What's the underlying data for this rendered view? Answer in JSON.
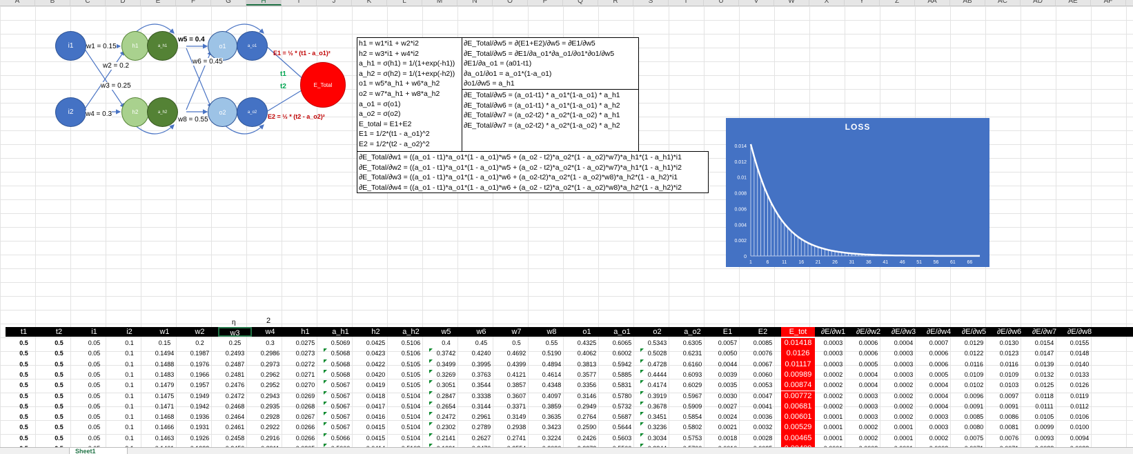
{
  "columns": [
    "A",
    "B",
    "C",
    "D",
    "E",
    "F",
    "G",
    "H",
    "I",
    "J",
    "K",
    "L",
    "M",
    "N",
    "O",
    "P",
    "Q",
    "R",
    "S",
    "T",
    "U",
    "V",
    "W",
    "X",
    "Y",
    "Z",
    "AA",
    "AB",
    "AC",
    "AD",
    "AE",
    "AF"
  ],
  "selected_column": "H",
  "diagram": {
    "nodes": {
      "i1": "i1",
      "i2": "i2",
      "h1": "h1",
      "h2": "h2",
      "a_h1": "a_h1",
      "a_h2": "a_h2",
      "o1": "o1",
      "o2": "o2",
      "a_o1": "a_o1",
      "a_o2": "a_o2",
      "E_total": "E_Total"
    },
    "weights": {
      "w1": "w1 = 0.15",
      "w2": "w2 = 0.2",
      "w3": "w3 = 0.25",
      "w4": "w4 = 0.3",
      "w5": "w5 = 0.4",
      "w6": "w6 = 0.45",
      "w8": "w8 = 0.55"
    },
    "targets": {
      "t1": "t1",
      "t2": "t2"
    },
    "errors": {
      "e1": "E1 = ½ * (t1 - a_o1)²",
      "e2": "E2 = ½ * (t2 - a_o2)²"
    }
  },
  "formulas_left": [
    "h1 = w1*i1 + w2*i2",
    "h2 = w3*i1 + w4*i2",
    "a_h1 = σ(h1) = 1/(1+exp(-h1))",
    "a_h2 = σ(h2) = 1/(1+exp(-h2))",
    "o1 = w5*a_h1 + w6*a_h2",
    "o2 = w7*a_h1 + w8*a_h2",
    "a_o1 = σ(o1)",
    "a_o2 = σ(o2)",
    "E_total = E1+E2",
    "E1 = 1/2*(t1 - a_o1)^2",
    "E2 = 1/2*(t2 - a_o2)^2"
  ],
  "formulas_right_top": [
    "∂E_Total/∂w5 = ∂(E1+E2)/∂w5 = ∂E1/∂w5",
    "∂E_Total/∂w5 = ∂E1/∂a_o1*∂a_o1/∂o1*∂o1/∂w5",
    "∂E1/∂a_o1 = (a01-t1)",
    "∂a_o1/∂o1 = a_o1*(1-a_o1)",
    "∂o1/∂w5 = a_h1"
  ],
  "formulas_right_bottom": [
    "∂E_Total/∂w5 = (a_o1-t1) * a_o1*(1-a_o1) * a_h1",
    "∂E_Total/∂w6 = (a_o1-t1) * a_o1*(1-a_o1) * a_h2",
    "∂E_Total/∂w7 = (a_o2-t2) * a_o2*(1-a_o2) * a_h1",
    "∂E_Total/∂w7 = (a_o2-t2) * a_o2*(1-a_o2) * a_h2"
  ],
  "formulas_wide": [
    "∂E_Total/∂w1 = ((a_o1 - t1)*a_o1*(1 - a_o1)*w5 + (a_o2 - t2)*a_o2*(1 - a_o2)*w7)*a_h1*(1 - a_h1)*i1",
    "∂E_Total/∂w2 = ((a_o1 - t1)*a_o1*(1 - a_o1)*w5 + (a_o2 - t2)*a_o2*(1 - a_o2)*w7)*a_h1*(1 - a_h1)*i2",
    "∂E_Total/∂w3 = ((a_o1 - t1)*a_o1*(1 - a_o1)*w6 + (a_o2-t2)*a_o2*(1 - a_o2)*w8)*a_h2*(1 - a_h2)*i1",
    "∂E_Total/∂w4 = ((a_o1 - t1)*a_o1*(1 - a_o1)*w6 + (a_o2 - t2)*a_o2*(1 - a_o2)*w8)*a_h2*(1 - a_h2)*i2"
  ],
  "eta": {
    "label": "η",
    "value": "2"
  },
  "chart_data": {
    "type": "area",
    "title": "LOSS",
    "xlabel": "",
    "ylabel": "",
    "ylim": [
      0,
      0.014
    ],
    "yticks": [
      "0",
      "0.002",
      "0.004",
      "0.006",
      "0.008",
      "0.01",
      "0.012",
      "0.014"
    ],
    "xticks": [
      "1",
      "6",
      "11",
      "16",
      "21",
      "26",
      "31",
      "36",
      "41",
      "46",
      "51",
      "56",
      "61",
      "66"
    ],
    "series": [
      {
        "values": [
          0.01418,
          0.0126,
          0.01117,
          0.00989,
          0.00874,
          0.00772,
          0.00681,
          0.00601,
          0.00529,
          0.00465,
          0.00409,
          0.0036,
          0.00316,
          0.00278,
          0.00244,
          0.00215,
          0.00189,
          0.00166,
          0.00146,
          0.00129,
          0.00113,
          0.001,
          0.00088,
          0.00077,
          0.00068,
          0.0006,
          0.00053,
          0.00047,
          0.00041,
          0.00036,
          0.00032,
          0.00028,
          0.00025,
          0.00022,
          0.00019,
          0.00017,
          0.00015,
          0.00013,
          0.00012,
          0.0001,
          9e-05,
          8e-05,
          7e-05,
          6e-05,
          6e-05,
          5e-05,
          4e-05,
          4e-05,
          3e-05,
          3e-05,
          3e-05,
          2e-05,
          2e-05,
          2e-05,
          2e-05,
          1e-05,
          1e-05,
          1e-05,
          1e-05,
          1e-05,
          1e-05,
          1e-05,
          1e-05,
          1e-05,
          1e-05,
          1e-05,
          1e-05,
          1e-05,
          1e-05
        ]
      }
    ],
    "grid": false,
    "colors": {
      "background": "#4472c4",
      "line": "#ffffff"
    }
  },
  "table": {
    "headers": [
      "t1",
      "t2",
      "i1",
      "i2",
      "w1",
      "w2",
      "w3",
      "w4",
      "h1",
      "a_h1",
      "h2",
      "a_h2",
      "w5",
      "w6",
      "w7",
      "w8",
      "o1",
      "a_o1",
      "o2",
      "a_o2",
      "E1",
      "E2",
      "E_tot",
      "∂E/∂w1",
      "∂E/∂w2",
      "∂E/∂w3",
      "∂E/∂w4",
      "∂E/∂w5",
      "∂E/∂w6",
      "∂E/∂w7",
      "∂E/∂w8"
    ],
    "rows": [
      [
        "0.5",
        "0.5",
        "0.05",
        "0.1",
        "0.15",
        "0.2",
        "0.25",
        "0.3",
        "0.0275",
        "0.5069",
        "0.0425",
        "0.5106",
        "0.4",
        "0.45",
        "0.5",
        "0.55",
        "0.4325",
        "0.6065",
        "0.5343",
        "0.6305",
        "0.0057",
        "0.0085",
        "0.01418",
        "0.0003",
        "0.0006",
        "0.0004",
        "0.0007",
        "0.0129",
        "0.0130",
        "0.0154",
        "0.0155"
      ],
      [
        "0.5",
        "0.5",
        "0.05",
        "0.1",
        "0.1494",
        "0.1987",
        "0.2493",
        "0.2986",
        "0.0273",
        "0.5068",
        "0.0423",
        "0.5106",
        "0.3742",
        "0.4240",
        "0.4692",
        "0.5190",
        "0.4062",
        "0.6002",
        "0.5028",
        "0.6231",
        "0.0050",
        "0.0076",
        "0.0126",
        "0.0003",
        "0.0006",
        "0.0003",
        "0.0006",
        "0.0122",
        "0.0123",
        "0.0147",
        "0.0148"
      ],
      [
        "0.5",
        "0.5",
        "0.05",
        "0.1",
        "0.1488",
        "0.1976",
        "0.2487",
        "0.2973",
        "0.0272",
        "0.5068",
        "0.0422",
        "0.5105",
        "0.3499",
        "0.3995",
        "0.4399",
        "0.4894",
        "0.3813",
        "0.5942",
        "0.4728",
        "0.6160",
        "0.0044",
        "0.0067",
        "0.01117",
        "0.0003",
        "0.0005",
        "0.0003",
        "0.0006",
        "0.0116",
        "0.0116",
        "0.0139",
        "0.0140"
      ],
      [
        "0.5",
        "0.5",
        "0.05",
        "0.1",
        "0.1483",
        "0.1966",
        "0.2481",
        "0.2962",
        "0.0271",
        "0.5068",
        "0.0420",
        "0.5105",
        "0.3269",
        "0.3763",
        "0.4121",
        "0.4614",
        "0.3577",
        "0.5885",
        "0.4444",
        "0.6093",
        "0.0039",
        "0.0060",
        "0.00989",
        "0.0002",
        "0.0004",
        "0.0003",
        "0.0005",
        "0.0109",
        "0.0109",
        "0.0132",
        "0.0133"
      ],
      [
        "0.5",
        "0.5",
        "0.05",
        "0.1",
        "0.1479",
        "0.1957",
        "0.2476",
        "0.2952",
        "0.0270",
        "0.5067",
        "0.0419",
        "0.5105",
        "0.3051",
        "0.3544",
        "0.3857",
        "0.4348",
        "0.3356",
        "0.5831",
        "0.4174",
        "0.6029",
        "0.0035",
        "0.0053",
        "0.00874",
        "0.0002",
        "0.0004",
        "0.0002",
        "0.0004",
        "0.0102",
        "0.0103",
        "0.0125",
        "0.0126"
      ],
      [
        "0.5",
        "0.5",
        "0.05",
        "0.1",
        "0.1475",
        "0.1949",
        "0.2472",
        "0.2943",
        "0.0269",
        "0.5067",
        "0.0418",
        "0.5104",
        "0.2847",
        "0.3338",
        "0.3607",
        "0.4097",
        "0.3146",
        "0.5780",
        "0.3919",
        "0.5967",
        "0.0030",
        "0.0047",
        "0.00772",
        "0.0002",
        "0.0003",
        "0.0002",
        "0.0004",
        "0.0096",
        "0.0097",
        "0.0118",
        "0.0119"
      ],
      [
        "0.5",
        "0.5",
        "0.05",
        "0.1",
        "0.1471",
        "0.1942",
        "0.2468",
        "0.2935",
        "0.0268",
        "0.5067",
        "0.0417",
        "0.5104",
        "0.2654",
        "0.3144",
        "0.3371",
        "0.3859",
        "0.2949",
        "0.5732",
        "0.3678",
        "0.5909",
        "0.0027",
        "0.0041",
        "0.00681",
        "0.0002",
        "0.0003",
        "0.0002",
        "0.0004",
        "0.0091",
        "0.0091",
        "0.0111",
        "0.0112"
      ],
      [
        "0.5",
        "0.5",
        "0.05",
        "0.1",
        "0.1468",
        "0.1936",
        "0.2464",
        "0.2928",
        "0.0267",
        "0.5067",
        "0.0416",
        "0.5104",
        "0.2472",
        "0.2961",
        "0.3149",
        "0.3635",
        "0.2764",
        "0.5687",
        "0.3451",
        "0.5854",
        "0.0024",
        "0.0036",
        "0.00601",
        "0.0001",
        "0.0003",
        "0.0002",
        "0.0003",
        "0.0085",
        "0.0086",
        "0.0105",
        "0.0106"
      ],
      [
        "0.5",
        "0.5",
        "0.05",
        "0.1",
        "0.1466",
        "0.1931",
        "0.2461",
        "0.2922",
        "0.0266",
        "0.5067",
        "0.0415",
        "0.5104",
        "0.2302",
        "0.2789",
        "0.2938",
        "0.3423",
        "0.2590",
        "0.5644",
        "0.3236",
        "0.5802",
        "0.0021",
        "0.0032",
        "0.00529",
        "0.0001",
        "0.0002",
        "0.0001",
        "0.0003",
        "0.0080",
        "0.0081",
        "0.0099",
        "0.0100"
      ],
      [
        "0.5",
        "0.5",
        "0.05",
        "0.1",
        "0.1463",
        "0.1926",
        "0.2458",
        "0.2916",
        "0.0266",
        "0.5066",
        "0.0415",
        "0.5104",
        "0.2141",
        "0.2627",
        "0.2741",
        "0.3224",
        "0.2426",
        "0.5603",
        "0.3034",
        "0.5753",
        "0.0018",
        "0.0028",
        "0.00465",
        "0.0001",
        "0.0002",
        "0.0001",
        "0.0002",
        "0.0075",
        "0.0076",
        "0.0093",
        "0.0094"
      ],
      [
        "0.5",
        "0.5",
        "0.05",
        "0.1",
        "0.1461",
        "0.1922",
        "0.2456",
        "0.2911",
        "0.0265",
        "0.5066",
        "0.0414",
        "0.5103",
        "0.1991",
        "0.2476",
        "0.2554",
        "0.3036",
        "0.2272",
        "0.5566",
        "0.2844",
        "0.5706",
        "0.0016",
        "0.0025",
        "0.00409",
        "0.0001",
        "0.0002",
        "0.0001",
        "0.0002",
        "0.0071",
        "0.0071",
        "0.0088",
        "0.0088"
      ]
    ]
  },
  "sheet_tab": "Sheet1"
}
